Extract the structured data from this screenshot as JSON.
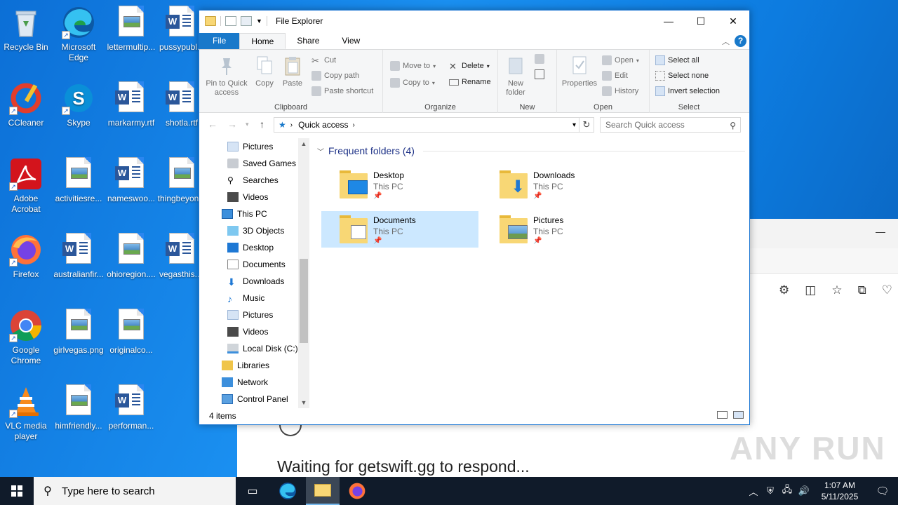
{
  "desktop": {
    "icons": [
      {
        "label": "Recycle Bin",
        "icon": "recycle-bin-icon"
      },
      {
        "label": "Microsoft Edge",
        "icon": "edge-icon"
      },
      {
        "label": "lettermultip...",
        "icon": "image-file-icon"
      },
      {
        "label": "pussypubl...",
        "icon": "word-doc-icon"
      },
      {
        "label": "CCleaner",
        "icon": "ccleaner-icon"
      },
      {
        "label": "Skype",
        "icon": "skype-icon"
      },
      {
        "label": "markarmy.rtf",
        "icon": "word-doc-icon"
      },
      {
        "label": "shotla.rtf",
        "icon": "word-doc-icon"
      },
      {
        "label": "Adobe Acrobat",
        "icon": "acrobat-icon"
      },
      {
        "label": "activitiesre...",
        "icon": "image-file-icon"
      },
      {
        "label": "nameswoo...",
        "icon": "word-doc-icon"
      },
      {
        "label": "thingbeyon...",
        "icon": "image-file-icon"
      },
      {
        "label": "Firefox",
        "icon": "firefox-icon"
      },
      {
        "label": "australianfir...",
        "icon": "word-doc-icon"
      },
      {
        "label": "ohioregion....",
        "icon": "image-file-icon"
      },
      {
        "label": "vegasthis....",
        "icon": "word-doc-icon"
      },
      {
        "label": "Google Chrome",
        "icon": "chrome-icon"
      },
      {
        "label": "girlvegas.png",
        "icon": "image-file-icon"
      },
      {
        "label": "originalco...",
        "icon": "image-file-icon"
      },
      {
        "label": "VLC media player",
        "icon": "vlc-icon"
      },
      {
        "label": "himfriendly...",
        "icon": "image-file-icon"
      },
      {
        "label": "performan...",
        "icon": "word-doc-icon"
      }
    ]
  },
  "browser": {
    "waiting_text": "Waiting for getswift.gg to respond..."
  },
  "watermark": "ANY RUN",
  "explorer": {
    "title": "File Explorer",
    "tabs": [
      "File",
      "Home",
      "Share",
      "View"
    ],
    "ribbon": {
      "clipboard": {
        "name": "Clipboard",
        "pin": "Pin to Quick access",
        "copy": "Copy",
        "paste": "Paste",
        "cut": "Cut",
        "copy_path": "Copy path",
        "paste_shortcut": "Paste shortcut"
      },
      "organize": {
        "name": "Organize",
        "move_to": "Move to",
        "copy_to": "Copy to",
        "delete": "Delete",
        "rename": "Rename"
      },
      "new": {
        "name": "New",
        "new_folder": "New folder"
      },
      "open": {
        "name": "Open",
        "properties": "Properties",
        "open": "Open",
        "edit": "Edit",
        "history": "History"
      },
      "select": {
        "name": "Select",
        "select_all": "Select all",
        "select_none": "Select none",
        "invert": "Invert selection"
      }
    },
    "address": {
      "crumb": "Quick access",
      "search_placeholder": "Search Quick access"
    },
    "nav": [
      {
        "label": "Pictures"
      },
      {
        "label": "Saved Games"
      },
      {
        "label": "Searches"
      },
      {
        "label": "Videos"
      },
      {
        "label": "This PC"
      },
      {
        "label": "3D Objects"
      },
      {
        "label": "Desktop"
      },
      {
        "label": "Documents"
      },
      {
        "label": "Downloads"
      },
      {
        "label": "Music"
      },
      {
        "label": "Pictures"
      },
      {
        "label": "Videos"
      },
      {
        "label": "Local Disk (C:)"
      },
      {
        "label": "Libraries"
      },
      {
        "label": "Network"
      },
      {
        "label": "Control Panel"
      }
    ],
    "section_title": "Frequent folders (4)",
    "folders": [
      {
        "name": "Desktop",
        "location": "This PC"
      },
      {
        "name": "Downloads",
        "location": "This PC"
      },
      {
        "name": "Documents",
        "location": "This PC"
      },
      {
        "name": "Pictures",
        "location": "This PC"
      }
    ],
    "status": "4 items"
  },
  "taskbar": {
    "search_placeholder": "Type here to search",
    "time": "1:07 AM",
    "date": "5/11/2025"
  }
}
